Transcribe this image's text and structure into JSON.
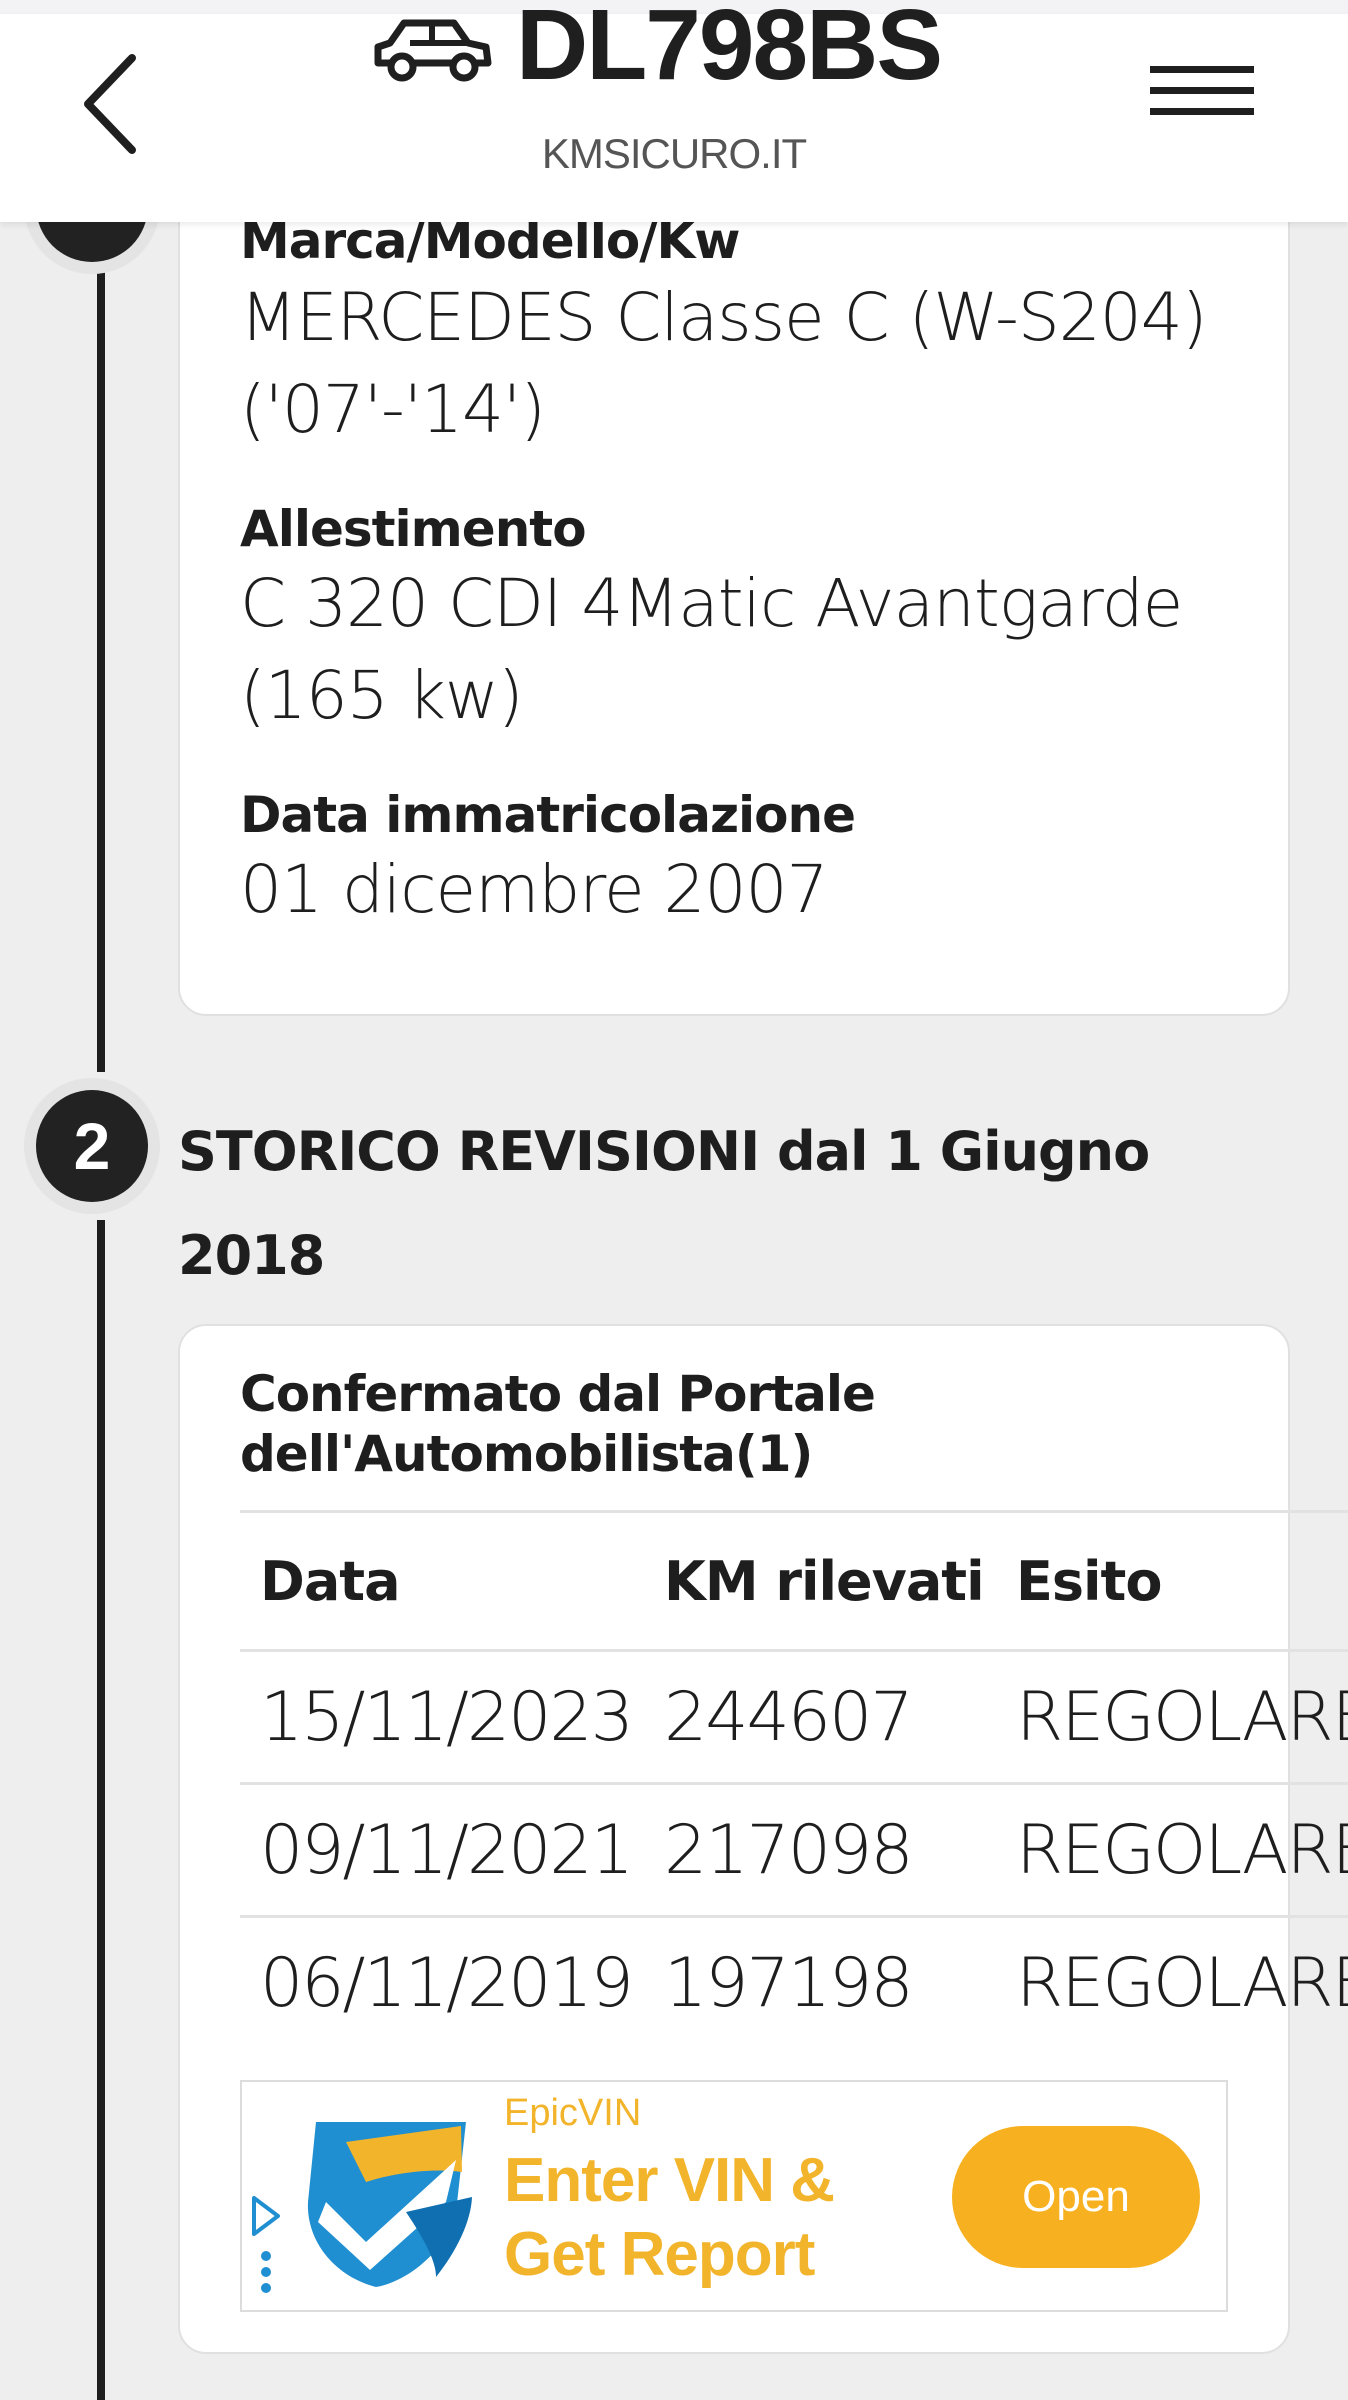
{
  "header": {
    "plate": "DL798BS",
    "site": "KMSICURO.IT",
    "icons": {
      "back": "chevron-left-icon",
      "car": "car-icon",
      "menu": "hamburger-menu-icon"
    }
  },
  "vehicle": {
    "model_label": "Marca/Modello/Kw",
    "model_value_line1": "MERCEDES Classe C (W-S204)",
    "model_value_line2": "('07'-'14')",
    "trim_label": "Allestimento",
    "trim_value_line1": "C 320 CDI 4Matic Avantgarde",
    "trim_value_line2": "(165 kw)",
    "reg_label": "Data immatricolazione",
    "reg_value": "01 dicembre 2007"
  },
  "section2": {
    "step": "2",
    "title": "STORICO REVISIONI dal 1 Giugno 2018",
    "note_line1": "Confermato dal Portale",
    "note_line2": "dell'Automobilista(1)",
    "table": {
      "headers": [
        "Data",
        "KM rilevati",
        "Esito"
      ],
      "rows": [
        [
          "15/11/2023",
          "244607",
          "REGOLARE"
        ],
        [
          "09/11/2021",
          "217098",
          "REGOLARE"
        ],
        [
          "06/11/2019",
          "197198",
          "REGOLARE"
        ]
      ]
    }
  },
  "ad": {
    "brand": "EpicVIN",
    "headline_line1": "Enter VIN &",
    "headline_line2": "Get Report",
    "cta": "Open",
    "accent": "#f2b42b",
    "logo_blue": "#1f8fd1"
  },
  "colors": {
    "background": "#eeeeee",
    "card": "#ffffff",
    "timeline": "#1e1e1e"
  }
}
